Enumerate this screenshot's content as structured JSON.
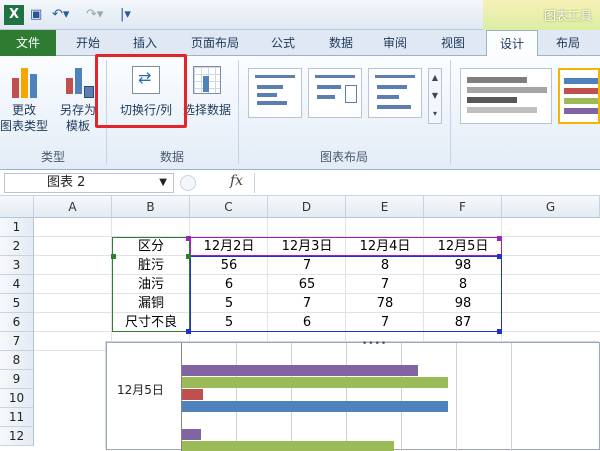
{
  "titlebar": {
    "context_tool_label": "图表工具"
  },
  "tabs": [
    {
      "label": "文件"
    },
    {
      "label": "开始"
    },
    {
      "label": "插入"
    },
    {
      "label": "页面布局"
    },
    {
      "label": "公式"
    },
    {
      "label": "数据"
    },
    {
      "label": "审阅"
    },
    {
      "label": "视图"
    },
    {
      "label": "设计"
    },
    {
      "label": "布局"
    }
  ],
  "ribbon": {
    "change_type": {
      "line1": "更改",
      "line2": "图表类型"
    },
    "save_template": {
      "line1": "另存为",
      "line2": "模板"
    },
    "switch_row_col": {
      "label": "切换行/列"
    },
    "select_data": {
      "label": "选择数据"
    },
    "groups": {
      "type": "类型",
      "data": "数据",
      "layout": "图表布局"
    }
  },
  "formula_bar": {
    "name_box": "图表 2",
    "fx_label": "fx",
    "formula": ""
  },
  "sheet": {
    "columns": [
      "A",
      "B",
      "C",
      "D",
      "E",
      "F",
      "G"
    ],
    "rows": [
      "1",
      "2",
      "3",
      "4",
      "5",
      "6",
      "7",
      "8",
      "9",
      "10",
      "11",
      "12"
    ],
    "table_header": [
      "区分",
      "12月2日",
      "12月3日",
      "12月4日",
      "12月5日"
    ],
    "table_rows": [
      [
        "脏污",
        "56",
        "7",
        "8",
        "98"
      ],
      [
        "油污",
        "6",
        "65",
        "7",
        "8"
      ],
      [
        "漏铜",
        "5",
        "7",
        "78",
        "98"
      ],
      [
        "尺寸不良",
        "5",
        "6",
        "7",
        "87"
      ]
    ]
  },
  "chart": {
    "category_label": "12月5日",
    "colors": [
      "#8064a2",
      "#9bbb59",
      "#c0504d",
      "#4f81bd"
    ]
  }
}
